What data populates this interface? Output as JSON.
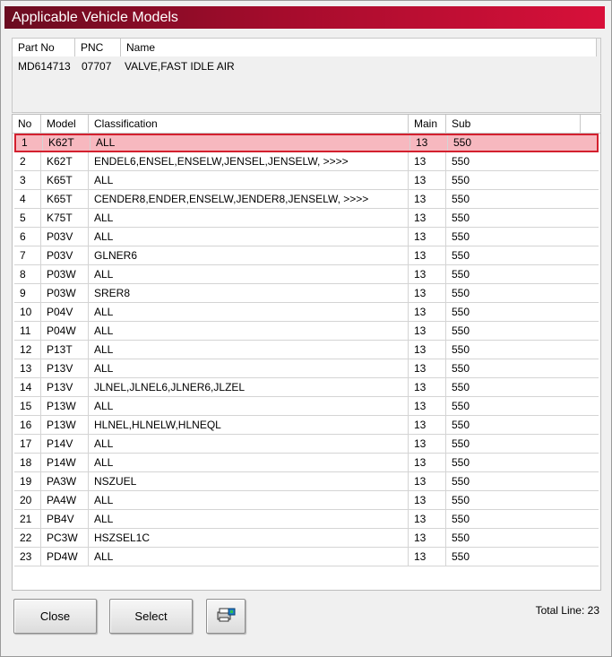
{
  "window": {
    "title": "Applicable Vehicle Models"
  },
  "part_header": {
    "part_no": "Part No",
    "pnc": "PNC",
    "name": "Name"
  },
  "part": {
    "part_no": "MD614713",
    "pnc": "07707",
    "name": "VALVE,FAST IDLE AIR"
  },
  "columns": {
    "no": "No",
    "model": "Model",
    "classification": "Classification",
    "main": "Main",
    "sub": "Sub"
  },
  "rows": [
    {
      "no": "1",
      "model": "K62T",
      "classification": "ALL",
      "main": "13",
      "sub": "550"
    },
    {
      "no": "2",
      "model": "K62T",
      "classification": "ENDEL6,ENSEL,ENSELW,JENSEL,JENSELW,  >>>>",
      "main": "13",
      "sub": "550"
    },
    {
      "no": "3",
      "model": "K65T",
      "classification": "ALL",
      "main": "13",
      "sub": "550"
    },
    {
      "no": "4",
      "model": "K65T",
      "classification": "CENDER8,ENDER,ENSELW,JENDER8,JENSELW,  >>>>",
      "main": "13",
      "sub": "550"
    },
    {
      "no": "5",
      "model": "K75T",
      "classification": "ALL",
      "main": "13",
      "sub": "550"
    },
    {
      "no": "6",
      "model": "P03V",
      "classification": "ALL",
      "main": "13",
      "sub": "550"
    },
    {
      "no": "7",
      "model": "P03V",
      "classification": "GLNER6",
      "main": "13",
      "sub": "550"
    },
    {
      "no": "8",
      "model": "P03W",
      "classification": "ALL",
      "main": "13",
      "sub": "550"
    },
    {
      "no": "9",
      "model": "P03W",
      "classification": "SRER8",
      "main": "13",
      "sub": "550"
    },
    {
      "no": "10",
      "model": "P04V",
      "classification": "ALL",
      "main": "13",
      "sub": "550"
    },
    {
      "no": "11",
      "model": "P04W",
      "classification": "ALL",
      "main": "13",
      "sub": "550"
    },
    {
      "no": "12",
      "model": "P13T",
      "classification": "ALL",
      "main": "13",
      "sub": "550"
    },
    {
      "no": "13",
      "model": "P13V",
      "classification": "ALL",
      "main": "13",
      "sub": "550"
    },
    {
      "no": "14",
      "model": "P13V",
      "classification": "JLNEL,JLNEL6,JLNER6,JLZEL",
      "main": "13",
      "sub": "550"
    },
    {
      "no": "15",
      "model": "P13W",
      "classification": "ALL",
      "main": "13",
      "sub": "550"
    },
    {
      "no": "16",
      "model": "P13W",
      "classification": "HLNEL,HLNELW,HLNEQL",
      "main": "13",
      "sub": "550"
    },
    {
      "no": "17",
      "model": "P14V",
      "classification": "ALL",
      "main": "13",
      "sub": "550"
    },
    {
      "no": "18",
      "model": "P14W",
      "classification": "ALL",
      "main": "13",
      "sub": "550"
    },
    {
      "no": "19",
      "model": "PA3W",
      "classification": "NSZUEL",
      "main": "13",
      "sub": "550"
    },
    {
      "no": "20",
      "model": "PA4W",
      "classification": "ALL",
      "main": "13",
      "sub": "550"
    },
    {
      "no": "21",
      "model": "PB4V",
      "classification": "ALL",
      "main": "13",
      "sub": "550"
    },
    {
      "no": "22",
      "model": "PC3W",
      "classification": "HSZSEL1C",
      "main": "13",
      "sub": "550"
    },
    {
      "no": "23",
      "model": "PD4W",
      "classification": "ALL",
      "main": "13",
      "sub": "550"
    }
  ],
  "selected_row": 0,
  "buttons": {
    "close": "Close",
    "select": "Select",
    "print_icon": "printer-icon"
  },
  "footer": {
    "total": "Total Line: 23"
  },
  "colors": {
    "title_start": "#6a0c20",
    "title_end": "#d8103a",
    "selection_fill": "#f7b8bf",
    "selection_border": "#d3202e"
  }
}
